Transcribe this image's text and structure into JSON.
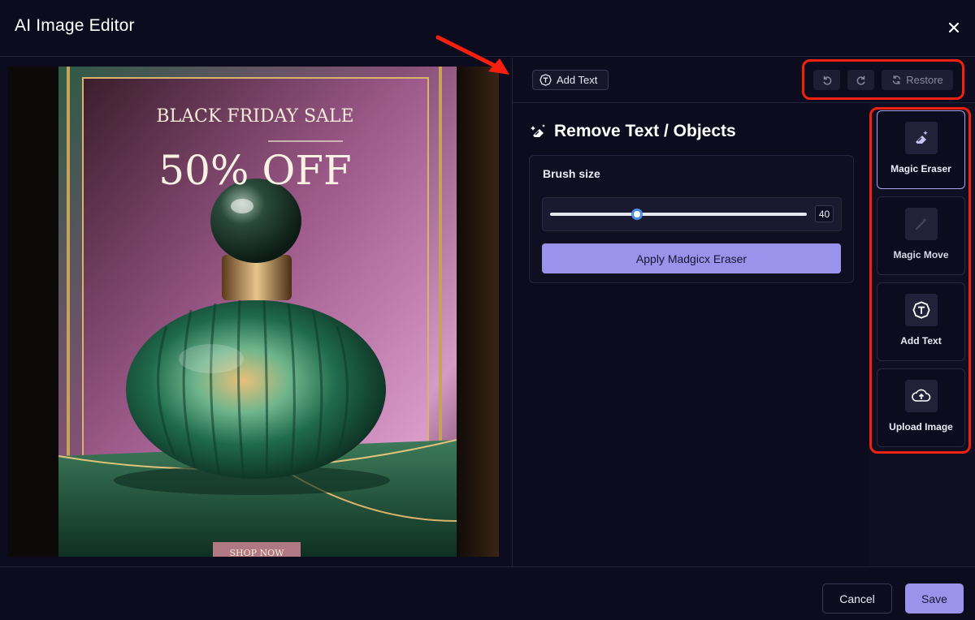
{
  "app": {
    "title": "AI Image Editor"
  },
  "toolbar": {
    "add_text_label": "Add Text",
    "restore_label": "Restore"
  },
  "panel": {
    "title": "Remove Text / Objects",
    "brush_size_label": "Brush size",
    "brush_size_value": "40",
    "brush_size_fraction": 0.34,
    "apply_label": "Apply Madgicx Eraser"
  },
  "tools": [
    {
      "label": "Magic Eraser",
      "icon": "magic-eraser-icon",
      "active": true
    },
    {
      "label": "Magic Move",
      "icon": "magic-move-icon",
      "active": false
    },
    {
      "label": "Add Text",
      "icon": "add-text-icon",
      "active": false
    },
    {
      "label": "Upload Image",
      "icon": "upload-cloud-icon",
      "active": false
    }
  ],
  "image": {
    "headline": "BLACK FRIDAY SALE",
    "offer": "50% OFF",
    "cta": "SHOP NOW"
  },
  "footer": {
    "cancel_label": "Cancel",
    "save_label": "Save"
  },
  "colors": {
    "background": "#0d0c1f",
    "accent": "#9b92ec",
    "annotation": "#f2200c"
  }
}
